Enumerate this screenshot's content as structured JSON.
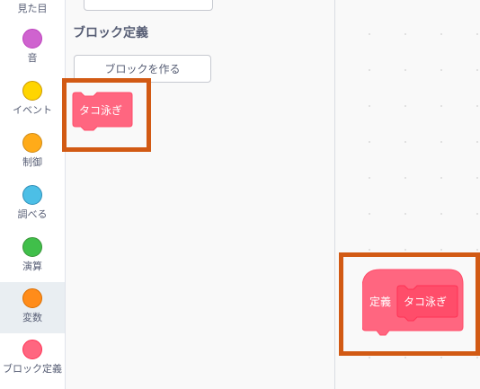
{
  "categories": [
    {
      "label": "見た目",
      "color": "#9966ff"
    },
    {
      "label": "音",
      "color": "#cf63cf"
    },
    {
      "label": "イベント",
      "color": "#ffd500"
    },
    {
      "label": "制御",
      "color": "#ffab19"
    },
    {
      "label": "調べる",
      "color": "#4cbfe6"
    },
    {
      "label": "演算",
      "color": "#40bf4a"
    },
    {
      "label": "変数",
      "color": "#ff8c1a"
    },
    {
      "label": "ブロック定義",
      "color": "#ff6680"
    }
  ],
  "selected_category": "変数",
  "flyout": {
    "section_title": "ブロック定義",
    "make_block_label": "ブロックを作る",
    "custom_block_label": "タコ泳ぎ"
  },
  "workspace": {
    "define_label": "定義",
    "define_block_name": "タコ泳ぎ"
  },
  "colors": {
    "my_blocks": "#ff6680",
    "my_blocks_dark": "#ff4d6a",
    "highlight": "#d25a14"
  }
}
